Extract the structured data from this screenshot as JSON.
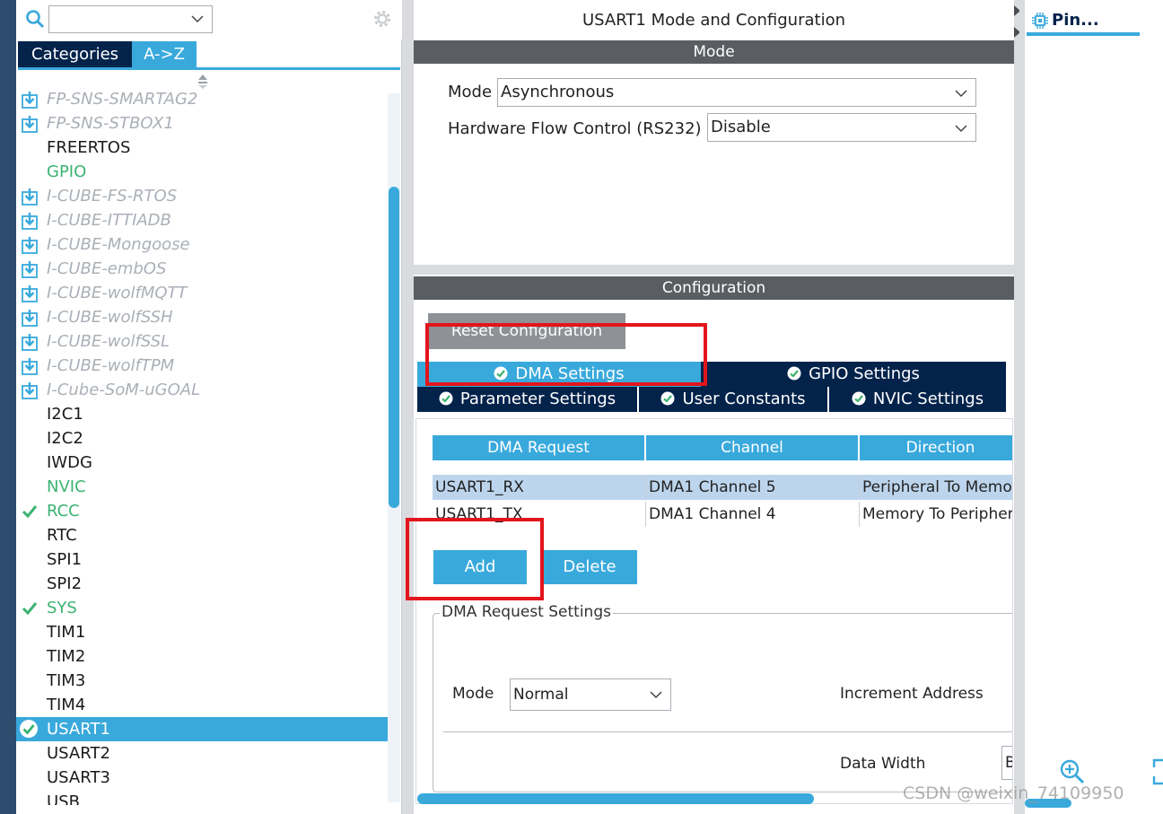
{
  "left": {
    "search_value": "",
    "tabs": [
      {
        "label": "Categories",
        "active": false
      },
      {
        "label": "A->Z",
        "active": true
      }
    ],
    "items": [
      {
        "label": "FP-SNS-SMARTAG2",
        "kind": "download"
      },
      {
        "label": "FP-SNS-STBOX1",
        "kind": "download"
      },
      {
        "label": "FREERTOS",
        "kind": "plain"
      },
      {
        "label": "GPIO",
        "kind": "green"
      },
      {
        "label": "I-CUBE-FS-RTOS",
        "kind": "download"
      },
      {
        "label": "I-CUBE-ITTIADB",
        "kind": "download"
      },
      {
        "label": "I-CUBE-Mongoose",
        "kind": "download"
      },
      {
        "label": "I-CUBE-embOS",
        "kind": "download"
      },
      {
        "label": "I-CUBE-wolfMQTT",
        "kind": "download"
      },
      {
        "label": "I-CUBE-wolfSSH",
        "kind": "download"
      },
      {
        "label": "I-CUBE-wolfSSL",
        "kind": "download"
      },
      {
        "label": "I-CUBE-wolfTPM",
        "kind": "download"
      },
      {
        "label": "I-Cube-SoM-uGOAL",
        "kind": "download"
      },
      {
        "label": "I2C1",
        "kind": "plain"
      },
      {
        "label": "I2C2",
        "kind": "plain"
      },
      {
        "label": "IWDG",
        "kind": "plain"
      },
      {
        "label": "NVIC",
        "kind": "green"
      },
      {
        "label": "RCC",
        "kind": "green-check"
      },
      {
        "label": "RTC",
        "kind": "plain"
      },
      {
        "label": "SPI1",
        "kind": "plain"
      },
      {
        "label": "SPI2",
        "kind": "plain"
      },
      {
        "label": "SYS",
        "kind": "green-check"
      },
      {
        "label": "TIM1",
        "kind": "plain"
      },
      {
        "label": "TIM2",
        "kind": "plain"
      },
      {
        "label": "TIM3",
        "kind": "plain"
      },
      {
        "label": "TIM4",
        "kind": "plain"
      },
      {
        "label": "USART1",
        "kind": "selected"
      },
      {
        "label": "USART2",
        "kind": "plain"
      },
      {
        "label": "USART3",
        "kind": "plain"
      },
      {
        "label": "USB",
        "kind": "plain"
      }
    ]
  },
  "main": {
    "title": "USART1 Mode and Configuration",
    "mode_header": "Mode",
    "mode_label": "Mode",
    "mode_value": "Asynchronous",
    "hw_flow_label": "Hardware Flow Control (RS232)",
    "hw_flow_value": "Disable",
    "config_header": "Configuration",
    "reset_button": "Reset Configuration",
    "tabs_row1": [
      {
        "label": "DMA Settings",
        "active": true
      },
      {
        "label": "GPIO Settings",
        "active": false
      }
    ],
    "tabs_row2": [
      {
        "label": "Parameter Settings"
      },
      {
        "label": "User Constants"
      },
      {
        "label": "NVIC Settings"
      }
    ],
    "table": {
      "headers": [
        "DMA Request",
        "Channel",
        "Direction"
      ],
      "rows": [
        [
          "USART1_RX",
          "DMA1 Channel 5",
          "Peripheral To Memory"
        ],
        [
          "USART1_TX",
          "DMA1 Channel 4",
          "Memory To Peripheral"
        ]
      ]
    },
    "add_button": "Add",
    "delete_button": "Delete",
    "dma_settings_legend": "DMA Request Settings",
    "dma_mode_label": "Mode",
    "dma_mode_value": "Normal",
    "increment_label": "Increment Address",
    "data_width_label": "Data Width",
    "data_width_value": "Byte"
  },
  "right": {
    "pinout_tab": "Pin..."
  },
  "watermark": "CSDN @weixin_74109950",
  "colors": {
    "accent": "#39a9dc",
    "navy": "#03234b",
    "annotation_red": "#e3151c",
    "enabled_green": "#3cb371"
  }
}
